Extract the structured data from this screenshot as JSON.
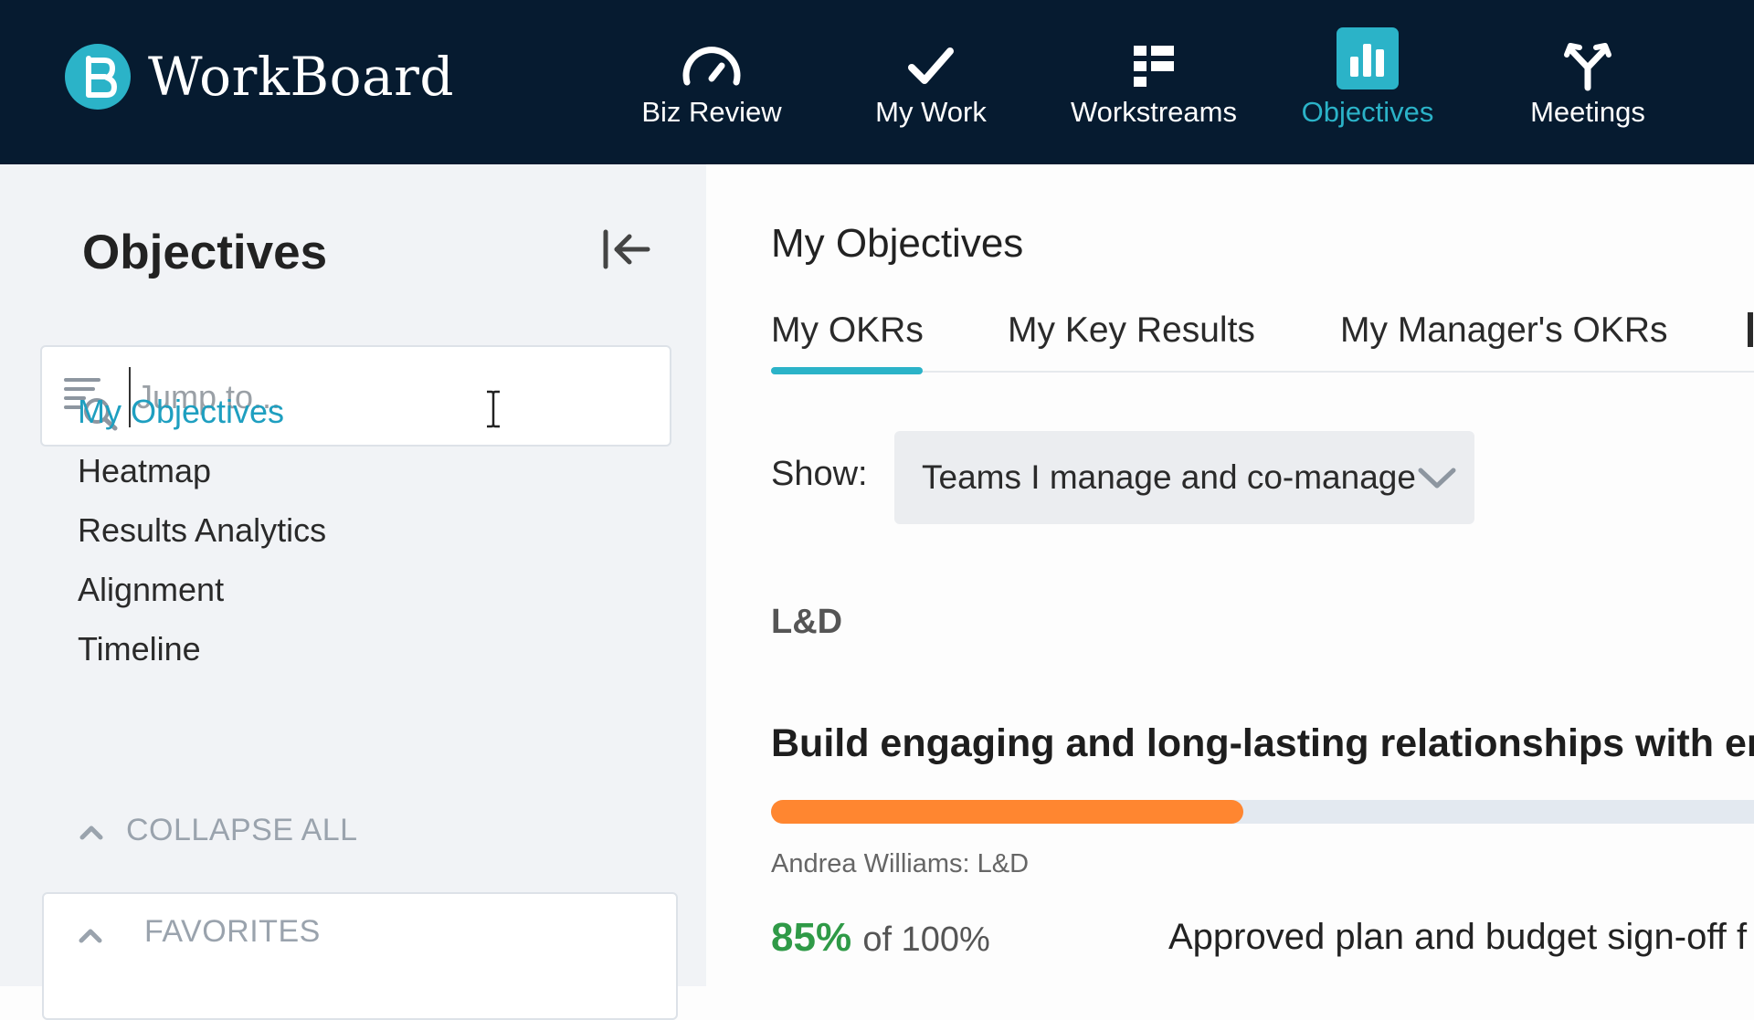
{
  "app": {
    "name": "WorkBoard",
    "accent_color": "#2bb3c8",
    "topbar_color": "#061b30"
  },
  "nav": {
    "items": [
      {
        "label": "Biz Review",
        "icon": "gauge-icon",
        "active": false
      },
      {
        "label": "My Work",
        "icon": "checkmark-icon",
        "active": false
      },
      {
        "label": "Workstreams",
        "icon": "grid-list-icon",
        "active": false
      },
      {
        "label": "Objectives",
        "icon": "bar-chart-icon",
        "active": true
      },
      {
        "label": "Meetings",
        "icon": "merge-arrows-icon",
        "active": false
      }
    ]
  },
  "sidebar": {
    "title": "Objectives",
    "search": {
      "placeholder": "Jump to...",
      "value": ""
    },
    "links": [
      {
        "label": "My Objectives",
        "active": true
      },
      {
        "label": "Heatmap",
        "active": false
      },
      {
        "label": "Results Analytics",
        "active": false
      },
      {
        "label": "Alignment",
        "active": false
      },
      {
        "label": "Timeline",
        "active": false
      }
    ],
    "collapse_all": "COLLAPSE ALL",
    "favorites": "FAVORITES"
  },
  "main": {
    "title": "My Objectives",
    "tabs": [
      {
        "label": "My OKRs",
        "active": true
      },
      {
        "label": "My Key Results",
        "active": false
      },
      {
        "label": "My Manager's OKRs",
        "active": false
      }
    ],
    "show": {
      "label": "Show:",
      "selected": "Teams I manage and co-manage"
    },
    "section": "L&D",
    "okr": {
      "title": "Build engaging and long-lasting relationships with empl",
      "progress_fraction": 0.47,
      "progress_color": "#ff8630",
      "owner": "Andrea Williams: L&D",
      "percent": "85%",
      "of_target": "of 100%",
      "key_result": "Approved plan and budget sign-off f"
    }
  }
}
